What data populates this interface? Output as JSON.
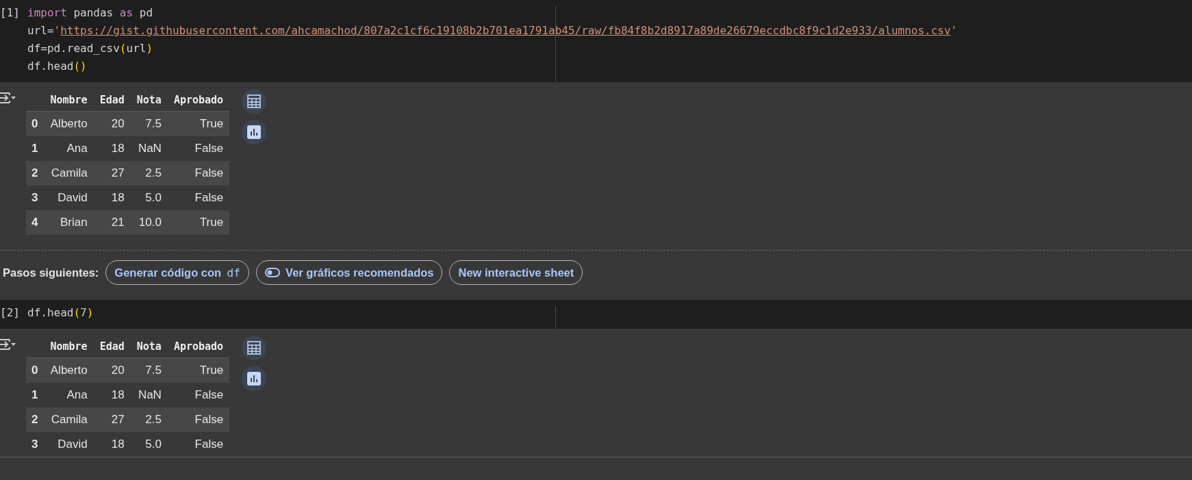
{
  "cells": [
    {
      "prompt": "[1]",
      "lines": [
        [
          {
            "kind": "keyword",
            "text": "import"
          },
          {
            "kind": "plain",
            "text": " pandas "
          },
          {
            "kind": "keyword",
            "text": "as"
          },
          {
            "kind": "plain",
            "text": " pd"
          }
        ],
        [
          {
            "kind": "plain",
            "text": "url="
          },
          {
            "kind": "string",
            "text": "'"
          },
          {
            "kind": "link",
            "text": "https://gist.githubusercontent.com/ahcamachod/807a2c1cf6c19108b2b701ea1791ab45/raw/fb84f8b2d8917a89de26679eccdbc8f9c1d2e933/alumnos.csv"
          },
          {
            "kind": "string",
            "text": "'"
          }
        ],
        [
          {
            "kind": "plain",
            "text": "df=pd.read_csv"
          },
          {
            "kind": "paren",
            "text": "("
          },
          {
            "kind": "plain",
            "text": "url"
          },
          {
            "kind": "paren",
            "text": ")"
          }
        ],
        [
          {
            "kind": "plain",
            "text": "df.head"
          },
          {
            "kind": "paren",
            "text": "()"
          }
        ]
      ],
      "output": {
        "columns": [
          "Nombre",
          "Edad",
          "Nota",
          "Aprobado"
        ],
        "rows": [
          {
            "index": "0",
            "cells": [
              "Alberto",
              "20",
              "7.5",
              "True"
            ]
          },
          {
            "index": "1",
            "cells": [
              "Ana",
              "18",
              "NaN",
              "False"
            ]
          },
          {
            "index": "2",
            "cells": [
              "Camila",
              "27",
              "2.5",
              "False"
            ]
          },
          {
            "index": "3",
            "cells": [
              "David",
              "18",
              "5.0",
              "False"
            ]
          },
          {
            "index": "4",
            "cells": [
              "Brian",
              "21",
              "10.0",
              "True"
            ]
          }
        ]
      },
      "next_steps": {
        "label": "Pasos siguientes:",
        "chips": [
          {
            "kind": "code",
            "text": "Generar código con",
            "code": "df"
          },
          {
            "kind": "toggle",
            "text": "Ver gráficos recomendados"
          },
          {
            "kind": "plain",
            "text": "New interactive sheet"
          }
        ]
      }
    },
    {
      "prompt": "[2]",
      "lines": [
        [
          {
            "kind": "plain",
            "text": "df.head"
          },
          {
            "kind": "paren",
            "text": "("
          },
          {
            "kind": "number",
            "text": "7"
          },
          {
            "kind": "paren",
            "text": ")"
          }
        ]
      ],
      "output": {
        "columns": [
          "Nombre",
          "Edad",
          "Nota",
          "Aprobado"
        ],
        "rows": [
          {
            "index": "0",
            "cells": [
              "Alberto",
              "20",
              "7.5",
              "True"
            ]
          },
          {
            "index": "1",
            "cells": [
              "Ana",
              "18",
              "NaN",
              "False"
            ]
          },
          {
            "index": "2",
            "cells": [
              "Camila",
              "27",
              "2.5",
              "False"
            ]
          },
          {
            "index": "3",
            "cells": [
              "David",
              "18",
              "5.0",
              "False"
            ]
          }
        ]
      }
    }
  ]
}
